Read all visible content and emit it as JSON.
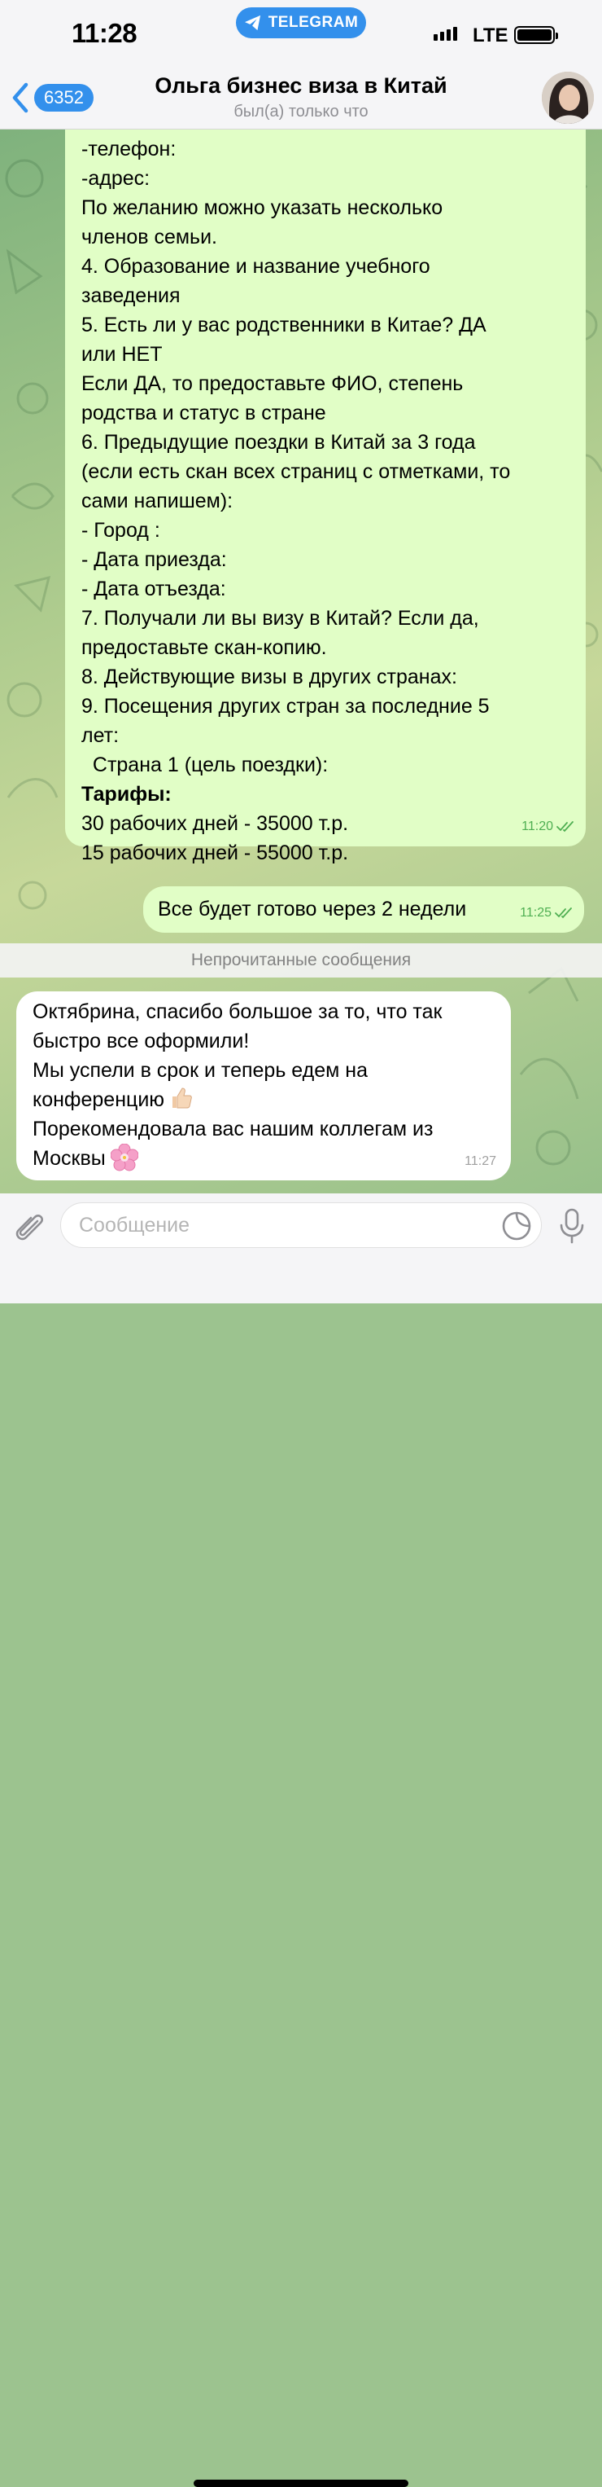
{
  "status_bar": {
    "time": "11:28",
    "app_pill": "TELEGRAM",
    "network": "LTE"
  },
  "header": {
    "back_count": "6352",
    "title": "Ольга бизнес виза в Китай",
    "subtitle": "был(а) только что"
  },
  "messages": [
    {
      "direction": "outgoing",
      "lines": [
        "-телефон:",
        "-адрес:",
        "По желанию можно указать несколько",
        "членов семьи.",
        "4. Образование и название учебного",
        "заведения",
        "5. Есть ли у вас родственники в Китае? ДА",
        "или НЕТ",
        "Если ДА, то предоставьте ФИО, степень",
        "родства и статус в стране",
        "6. Предыдущие поездки в Китай за 3 года",
        "(если есть скан всех страниц с отметками, то",
        "сами напишем):",
        "- Город :",
        "- Дата приезда:",
        "- Дата отъезда:",
        "7. Получали ли вы визу в Китай? Если да,",
        "предоставьте скан-копию.",
        "8. Действующие визы в других странах:",
        "9. Посещения других стран за последние 5",
        "лет:",
        "  Страна 1 (цель поездки):",
        "Тарифы:",
        "30 рабочих дней - 35000 т.р.",
        "15 рабочих дней - 55000 т.р."
      ],
      "time": "11:20",
      "status": "read"
    },
    {
      "direction": "outgoing",
      "text": "Все будет готово через 2 недели",
      "time": "11:25",
      "status": "read"
    },
    {
      "direction": "incoming",
      "lines": [
        "Октябрина, спасибо большое за то, что так",
        "быстро все оформили!",
        "Мы успели в срок и теперь едем на",
        "конференцию",
        "Порекомендовала вас нашим коллегам из",
        "Москвы"
      ],
      "time": "11:27"
    }
  ],
  "unread_divider": "Непрочитанные сообщения",
  "input": {
    "placeholder": "Сообщение",
    "value": ""
  },
  "colors": {
    "accent": "#3390ec",
    "outgoing_bubble": "#e1fec6",
    "incoming_bubble": "#ffffff",
    "check_color": "#4faf52"
  },
  "icons": [
    "telegram-icon",
    "chevron-left-icon",
    "check-double-icon",
    "thumbs-up-emoji",
    "cherry-blossom-emoji",
    "paperclip-icon",
    "sticker-icon",
    "microphone-icon"
  ]
}
